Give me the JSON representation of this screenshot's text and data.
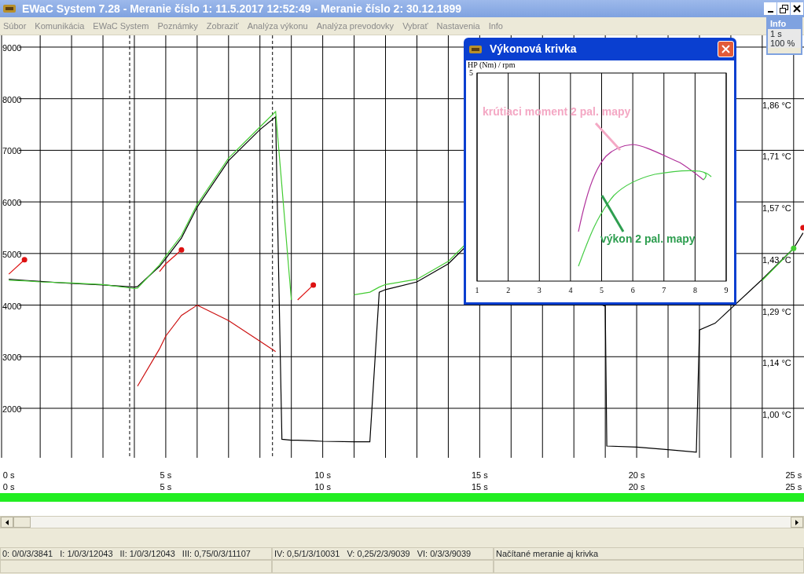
{
  "window": {
    "title": "EWaC System 7.28 - Meranie číslo 1: 11.5.2017 12:52:49 - Meranie číslo 2: 30.12.1899"
  },
  "menu": [
    "Súbor",
    "Komunikácia",
    "EWaC System",
    "Poznámky",
    "Zobraziť",
    "Analýza výkonu",
    "Analýza prevodovky",
    "Vybrať",
    "Nastavenia",
    "Info"
  ],
  "info_panel": {
    "title": "Info",
    "lines": [
      "1 s",
      "100 %"
    ]
  },
  "main_chart": {
    "chart_data": {
      "type": "line",
      "x": [
        0,
        0.5,
        1,
        2,
        3,
        4,
        4.1,
        4.8,
        5,
        5.5,
        6,
        7,
        8,
        8.5,
        8.7,
        9,
        9.2,
        9.7,
        10,
        11,
        11.5,
        11.8,
        12,
        13,
        14,
        14.5,
        19,
        19.05,
        20,
        21,
        21.9,
        22,
        22.5,
        24,
        25,
        25.3
      ],
      "series": [
        {
          "color": "#000000",
          "values": [
            4500,
            4480,
            4460,
            4420,
            4390,
            4350,
            4360,
            4750,
            4900,
            5300,
            5900,
            6800,
            7400,
            7650,
            1400,
            1380,
            1380,
            1370,
            1360,
            1350,
            1350,
            4250,
            4300,
            4450,
            4800,
            5100,
            3980,
            1270,
            1250,
            1200,
            1150,
            3520,
            3650,
            4500,
            5100,
            5400
          ]
        },
        {
          "color": "#44cc33",
          "values": [
            4480,
            4470,
            4450,
            4430,
            4400,
            4320,
            4330,
            4780,
            4950,
            5350,
            5950,
            6850,
            7450,
            7750,
            6300,
            4100,
            null,
            null,
            null,
            4200,
            4250,
            4350,
            4400,
            4500,
            4850,
            5150,
            null,
            null,
            null,
            null,
            null,
            null,
            null,
            4480,
            5100,
            null
          ]
        },
        {
          "color": "#cc1111",
          "values": [
            null,
            null,
            null,
            null,
            null,
            null,
            2430,
            3150,
            3400,
            3800,
            4000,
            3700,
            3300,
            3100,
            null,
            null,
            null,
            null,
            null,
            null,
            null,
            null,
            null,
            null,
            null,
            null,
            null,
            null,
            null,
            null,
            null,
            null,
            null,
            null,
            null,
            null
          ]
        },
        {
          "color": "#dd1111",
          "values": [
            4600,
            4880,
            null,
            null,
            null,
            null,
            null,
            4650,
            4800,
            5070,
            null,
            null,
            null,
            null,
            null,
            null,
            4100,
            4390,
            null,
            null,
            null,
            null,
            null,
            null,
            null,
            null,
            null,
            null,
            null,
            null,
            null,
            null,
            null,
            null,
            null,
            5500
          ]
        }
      ],
      "grid": true,
      "xlim": [
        -0.28,
        25.33
      ],
      "ylim": [
        1041,
        9228
      ],
      "xticks": [
        {
          "value": 0,
          "label": "0 s"
        },
        {
          "value": 5,
          "label": "5 s"
        },
        {
          "value": 10,
          "label": "10 s"
        },
        {
          "value": 15,
          "label": "15 s"
        },
        {
          "value": 20,
          "label": "20 s"
        },
        {
          "value": 25,
          "label": "25 s"
        }
      ],
      "yticks": [
        {
          "value": 2000,
          "label": "2000"
        },
        {
          "value": 3000,
          "label": "3000"
        },
        {
          "value": 4000,
          "label": "4000"
        },
        {
          "value": 5000,
          "label": "5000"
        },
        {
          "value": 6000,
          "label": "6000"
        },
        {
          "value": 7000,
          "label": "7000"
        },
        {
          "value": 8000,
          "label": "8000"
        },
        {
          "value": 9000,
          "label": "9000"
        }
      ],
      "ref_lines": [
        {
          "axis": "x",
          "value": 3.85
        },
        {
          "axis": "x",
          "value": 8.4
        }
      ]
    },
    "right_axis_labels": [
      "1,86 °C",
      "1,71 °C",
      "1,57 °C",
      "1,43 °C",
      "1,29 °C",
      "1,14 °C",
      "1,00 °C"
    ],
    "second_time_row": [
      "0 s",
      "5 s",
      "10 s",
      "15 s",
      "20 s",
      "25 s"
    ]
  },
  "progress": {
    "level": 1
  },
  "popup": {
    "title": "Výkonová krivka",
    "axis_title": "HP (Nm) / rpm",
    "top_label": "5",
    "x_labels": [
      "1",
      "2",
      "3",
      "4",
      "5",
      "6",
      "7",
      "8",
      "9"
    ],
    "annotations": [
      {
        "text": "krútiaci moment 2 pal. mapy"
      },
      {
        "text": "výkon 2 pal. mapy"
      }
    ]
  },
  "status_bar": [
    {
      "items": [
        "0: 0/0/3/3841",
        "I: 1/0/3/12043",
        "II: 1/0/3/12043",
        "III: 0,75/0/3/11107"
      ]
    },
    {
      "items": [
        "IV: 0,5/1/3/10031",
        "V: 0,25/2/3/9039",
        "VI: 0/3/3/9039"
      ]
    },
    {
      "items": [
        "Načítané meranie aj krivka"
      ]
    }
  ]
}
